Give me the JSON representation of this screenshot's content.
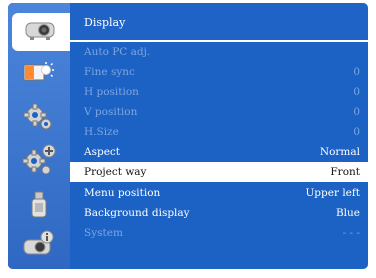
{
  "menu_title": "Display",
  "colors": {
    "frame_blue": "#1c62c4",
    "disabled_text": "#7ea6df",
    "selected_row": "#ffffff"
  },
  "sidebar": {
    "items": [
      {
        "icon": "display-icon",
        "active": true
      },
      {
        "icon": "picture-adjust-icon",
        "active": false
      },
      {
        "icon": "setting-gear-icon",
        "active": false
      },
      {
        "icon": "expanded-setting-gears-icon",
        "active": false
      },
      {
        "icon": "usb-memory-icon",
        "active": false
      },
      {
        "icon": "information-icon",
        "active": false
      }
    ]
  },
  "rows": [
    {
      "label": "Auto PC adj.",
      "value": "",
      "state": "disabled"
    },
    {
      "label": "Fine sync",
      "value": "0",
      "state": "disabled"
    },
    {
      "label": "H position",
      "value": "0",
      "state": "disabled"
    },
    {
      "label": "V position",
      "value": "0",
      "state": "disabled"
    },
    {
      "label": "H.Size",
      "value": "0",
      "state": "disabled"
    },
    {
      "label": "Aspect",
      "value": "Normal",
      "state": "enabled"
    },
    {
      "label": "Project way",
      "value": "Front",
      "state": "selected"
    },
    {
      "label": "Menu position",
      "value": "Upper left",
      "state": "enabled"
    },
    {
      "label": "Background display",
      "value": "Blue",
      "state": "enabled"
    },
    {
      "label": "System",
      "value": "- - -",
      "state": "disabled"
    }
  ]
}
